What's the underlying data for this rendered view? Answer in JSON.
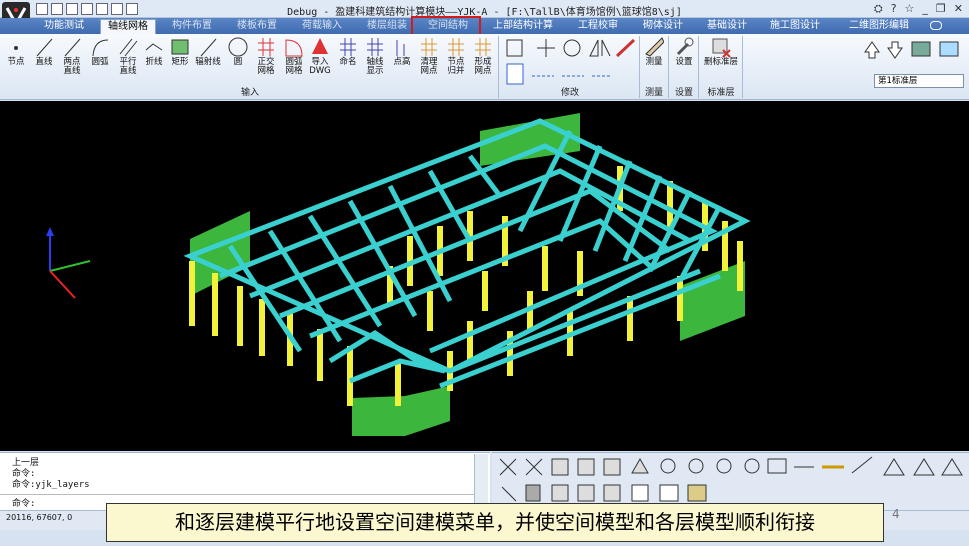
{
  "window": {
    "title": "Debug - 盈建科建筑结构计算模块——YJK-A - [F:\\TallB\\体育场馆例\\篮球馆8\\sj]",
    "controls": [
      "⛭",
      "?",
      "☆",
      "_",
      "❐",
      "✕"
    ]
  },
  "tabs": [
    {
      "label": "功能测试"
    },
    {
      "label": "轴线网格"
    },
    {
      "label": "构件布置"
    },
    {
      "label": "楼板布置"
    },
    {
      "label": "荷载输入"
    },
    {
      "label": "楼层组装"
    },
    {
      "label": "空间结构"
    },
    {
      "label": "上部结构计算"
    },
    {
      "label": "工程校审"
    },
    {
      "label": "砌体设计"
    },
    {
      "label": "基础设计"
    },
    {
      "label": "施工图设计"
    },
    {
      "label": "二维图形编辑"
    }
  ],
  "ribbon": {
    "input": [
      {
        "label": "节点"
      },
      {
        "label": "直线"
      },
      {
        "label": "两点\n直线"
      },
      {
        "label": "圆弧"
      },
      {
        "label": "平行\n直线"
      },
      {
        "label": "折线"
      },
      {
        "label": "矩形"
      },
      {
        "label": "辐射线"
      },
      {
        "label": "圆"
      },
      {
        "label": "正交\n网格"
      },
      {
        "label": "圆弧\n网格"
      },
      {
        "label": "导入\nDWG"
      },
      {
        "label": "命名"
      },
      {
        "label": "轴线\n显示"
      },
      {
        "label": "点高"
      },
      {
        "label": "清理\n网点"
      },
      {
        "label": "节点\n归并"
      },
      {
        "label": "形成\n网点"
      }
    ],
    "measure": {
      "label": "测量"
    },
    "settings": {
      "label": "设置"
    },
    "delete_marks": {
      "label": "删标准层"
    },
    "groups": {
      "input": "输入",
      "modify": "修改",
      "measure": "测量",
      "settings": "设置",
      "standard_floor": "标准层"
    },
    "floor_select": "第1标准层"
  },
  "command": {
    "lines": [
      "上一层",
      "命令:",
      "命令:yjk_layers"
    ],
    "prompt": "命令:"
  },
  "status": {
    "coord": "20116, 67607, 0"
  },
  "caption": "和逐层建模平行地设置空间建模菜单，并使空间模型和各层模型顺利衔接",
  "page_number": "4",
  "colors": {
    "beam": "#33cccc",
    "column": "#e6e633",
    "wall": "#33b833",
    "background": "#000000",
    "highlight": "#d21c1c"
  }
}
